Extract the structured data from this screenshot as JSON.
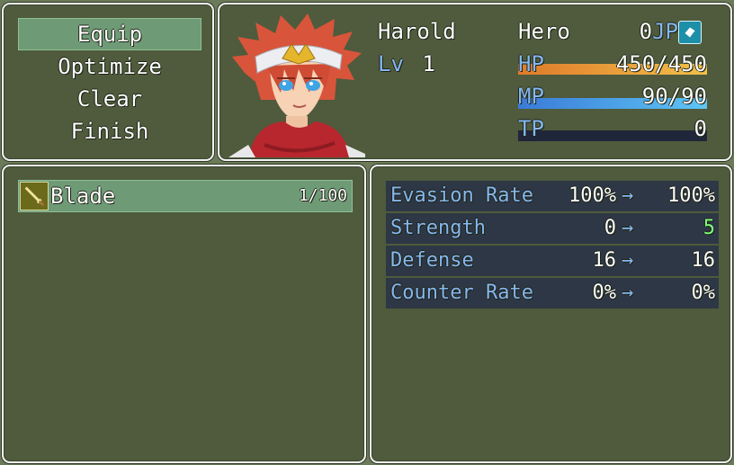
{
  "commands": {
    "items": [
      "Equip",
      "Optimize",
      "Clear",
      "Finish"
    ],
    "selected": 0
  },
  "actor": {
    "name": "Harold",
    "level_label": "Lv",
    "level": "1",
    "class": "Hero",
    "jp_value": "0",
    "jp_label": "JP",
    "hp_label": "HP",
    "hp_text": "450/450",
    "hp_ratio": 1.0,
    "mp_label": "MP",
    "mp_text": "90/90",
    "mp_ratio": 1.0,
    "tp_label": "TP",
    "tp_text": "0",
    "tp_ratio": 0.0
  },
  "item_list": {
    "items": [
      {
        "name": "Blade",
        "count": "1/100",
        "icon": "sword-icon"
      }
    ]
  },
  "params": {
    "arrow": "→",
    "rows": [
      {
        "name": "Evasion Rate",
        "current": "100%",
        "new": "100%",
        "new_color": "#ffffff"
      },
      {
        "name": "Strength",
        "current": "0",
        "new": "5",
        "new_color": "#80ff80"
      },
      {
        "name": "Defense",
        "current": "16",
        "new": "16",
        "new_color": "#ffffff"
      },
      {
        "name": "Counter Rate",
        "current": "0%",
        "new": "0%",
        "new_color": "#ffffff"
      }
    ]
  },
  "colors": {
    "hp_gauge": [
      "#e07a2a",
      "#f2c04a"
    ],
    "mp_gauge": [
      "#3a7ad8",
      "#5ec6f4"
    ],
    "system_blue": "#86b7f0",
    "power_up_green": "#80ff80"
  }
}
